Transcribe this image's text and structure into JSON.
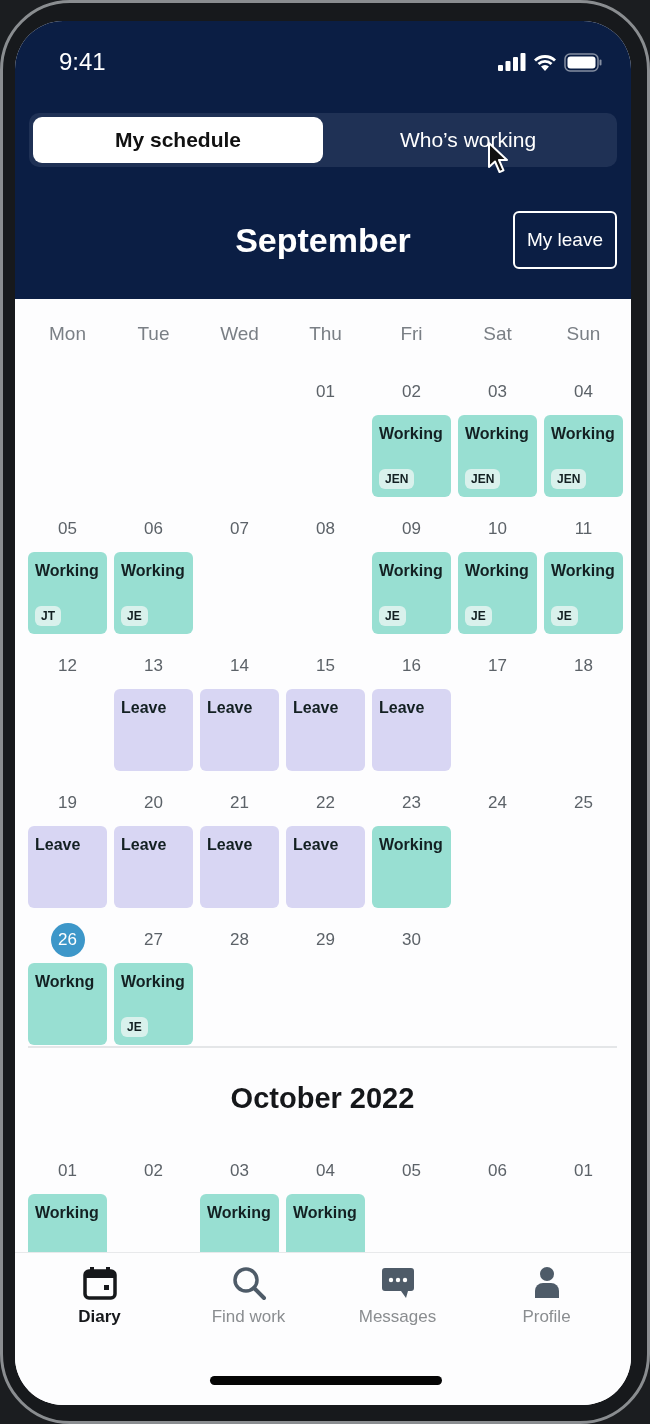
{
  "status_bar": {
    "time": "9:41"
  },
  "tabs": [
    {
      "label": "My schedule",
      "selected": true
    },
    {
      "label": "Who’s working",
      "selected": false
    }
  ],
  "header": {
    "title": "September",
    "action": "My leave"
  },
  "weekdays": [
    "Mon",
    "Tue",
    "Wed",
    "Thu",
    "Fri",
    "Sat",
    "Sun"
  ],
  "months": [
    {
      "weeks": [
        [
          {
            "kind": "blank"
          },
          {
            "kind": "blank"
          },
          {
            "kind": "blank"
          },
          {
            "kind": "date",
            "day": "01",
            "today": false
          },
          {
            "kind": "date",
            "day": "02",
            "today": false,
            "entry": {
              "kind": "working",
              "label": "Working",
              "badge": "JEN"
            }
          },
          {
            "kind": "date",
            "day": "03",
            "today": false,
            "entry": {
              "kind": "working",
              "label": "Working",
              "badge": "JEN"
            }
          },
          {
            "kind": "date",
            "day": "04",
            "today": false,
            "entry": {
              "kind": "working",
              "label": "Working",
              "badge": "JEN"
            }
          }
        ],
        [
          {
            "kind": "date",
            "day": "05",
            "today": false,
            "entry": {
              "kind": "working",
              "label": "Working",
              "badge": "JT"
            }
          },
          {
            "kind": "date",
            "day": "06",
            "today": false,
            "entry": {
              "kind": "working",
              "label": "Working",
              "badge": "JE"
            }
          },
          {
            "kind": "date",
            "day": "07",
            "today": false
          },
          {
            "kind": "date",
            "day": "08",
            "today": false
          },
          {
            "kind": "date",
            "day": "09",
            "today": false,
            "entry": {
              "kind": "working",
              "label": "Working",
              "badge": "JE"
            }
          },
          {
            "kind": "date",
            "day": "10",
            "today": false,
            "entry": {
              "kind": "working",
              "label": "Working",
              "badge": "JE"
            }
          },
          {
            "kind": "date",
            "day": "11",
            "today": false,
            "entry": {
              "kind": "working",
              "label": "Working",
              "badge": "JE"
            }
          }
        ],
        [
          {
            "kind": "date",
            "day": "12",
            "today": false
          },
          {
            "kind": "date",
            "day": "13",
            "today": false,
            "entry": {
              "kind": "leave",
              "label": "Leave"
            }
          },
          {
            "kind": "date",
            "day": "14",
            "today": false,
            "entry": {
              "kind": "leave",
              "label": "Leave"
            }
          },
          {
            "kind": "date",
            "day": "15",
            "today": false,
            "entry": {
              "kind": "leave",
              "label": "Leave"
            }
          },
          {
            "kind": "date",
            "day": "16",
            "today": false,
            "entry": {
              "kind": "leave",
              "label": "Leave"
            }
          },
          {
            "kind": "date",
            "day": "17",
            "today": false
          },
          {
            "kind": "date",
            "day": "18",
            "today": false
          }
        ],
        [
          {
            "kind": "date",
            "day": "19",
            "today": false,
            "entry": {
              "kind": "leave",
              "label": "Leave"
            }
          },
          {
            "kind": "date",
            "day": "20",
            "today": false,
            "entry": {
              "kind": "leave",
              "label": "Leave"
            }
          },
          {
            "kind": "date",
            "day": "21",
            "today": false,
            "entry": {
              "kind": "leave",
              "label": "Leave"
            }
          },
          {
            "kind": "date",
            "day": "22",
            "today": false,
            "entry": {
              "kind": "leave",
              "label": "Leave"
            }
          },
          {
            "kind": "date",
            "day": "23",
            "today": false,
            "entry": {
              "kind": "working",
              "label": "Working"
            }
          },
          {
            "kind": "date",
            "day": "24",
            "today": false
          },
          {
            "kind": "date",
            "day": "25",
            "today": false
          }
        ],
        [
          {
            "kind": "date",
            "day": "26",
            "today": true,
            "entry": {
              "kind": "working",
              "label": "Workng"
            }
          },
          {
            "kind": "date",
            "day": "27",
            "today": false,
            "entry": {
              "kind": "working",
              "label": "Working",
              "badge": "JE"
            }
          },
          {
            "kind": "date",
            "day": "28",
            "today": false
          },
          {
            "kind": "date",
            "day": "29",
            "today": false
          },
          {
            "kind": "date",
            "day": "30",
            "today": false
          },
          {
            "kind": "blank"
          },
          {
            "kind": "blank"
          }
        ]
      ]
    },
    {
      "title": "October 2022",
      "weeks": [
        [
          {
            "kind": "date",
            "day": "01",
            "today": false,
            "entry": {
              "kind": "working",
              "label": "Working"
            }
          },
          {
            "kind": "date",
            "day": "02",
            "today": false
          },
          {
            "kind": "date",
            "day": "03",
            "today": false,
            "entry": {
              "kind": "working",
              "label": "Working"
            }
          },
          {
            "kind": "date",
            "day": "04",
            "today": false,
            "entry": {
              "kind": "working",
              "label": "Working"
            }
          },
          {
            "kind": "date",
            "day": "05",
            "today": false
          },
          {
            "kind": "date",
            "day": "06",
            "today": false
          },
          {
            "kind": "date",
            "day": "01",
            "today": false
          }
        ]
      ]
    }
  ],
  "nav": [
    {
      "label": "Diary",
      "selected": true
    },
    {
      "label": "Find work",
      "selected": false
    },
    {
      "label": "Messages",
      "selected": false
    },
    {
      "label": "Profile",
      "selected": false
    }
  ]
}
